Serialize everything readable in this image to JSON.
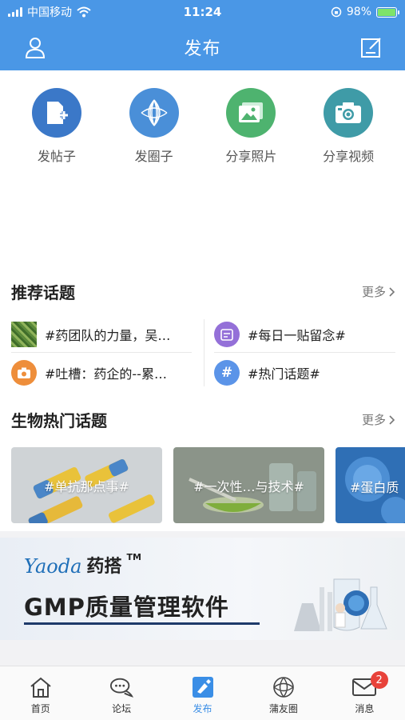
{
  "status_bar": {
    "carrier": "中国移动",
    "time": "11:24",
    "battery": "98%",
    "battery_level": 0.98
  },
  "header": {
    "title": "发布"
  },
  "actions": [
    {
      "label": "发帖子",
      "icon": "post-icon",
      "color": "#3b78c8"
    },
    {
      "label": "发圈子",
      "icon": "circle-icon",
      "color": "#4a8fd8"
    },
    {
      "label": "分享照片",
      "icon": "photo-icon",
      "color": "#4eb36f"
    },
    {
      "label": "分享视频",
      "icon": "camera-icon",
      "color": "#3f9ba7"
    }
  ],
  "recommended": {
    "heading": "推荐话题",
    "more": "更多",
    "topics": [
      {
        "text": "#药团队的力量，吴…",
        "icon": "thumbnail-icon"
      },
      {
        "text": "#每日一贴留念#",
        "icon": "daily-icon",
        "color": "#9470d8"
      },
      {
        "text": "#吐槽：药企的--累…",
        "icon": "camera-icon",
        "color": "#ee8e3b"
      },
      {
        "text": "#热门话题#",
        "icon": "hashtag-icon",
        "color": "#5b94e8"
      }
    ]
  },
  "bio_hot": {
    "heading": "生物热门话题",
    "more": "更多",
    "cards": [
      {
        "text": "#单抗那点事#"
      },
      {
        "text": "#一次性…与技术#"
      },
      {
        "text": "#蛋白质"
      }
    ]
  },
  "banner": {
    "brand": "Yaoda",
    "brand_cn": "药搭",
    "tm": "TM",
    "headline": "GMP质量管理软件"
  },
  "tabs": [
    {
      "label": "首页",
      "icon": "home-icon"
    },
    {
      "label": "论坛",
      "icon": "forum-icon"
    },
    {
      "label": "发布",
      "icon": "publish-icon",
      "active": true
    },
    {
      "label": "蒲友圈",
      "icon": "friends-circle-icon"
    },
    {
      "label": "消息",
      "icon": "mail-icon",
      "badge": "2"
    }
  ],
  "colors": {
    "primary": "#4a97e6",
    "badge": "#e8423a"
  }
}
